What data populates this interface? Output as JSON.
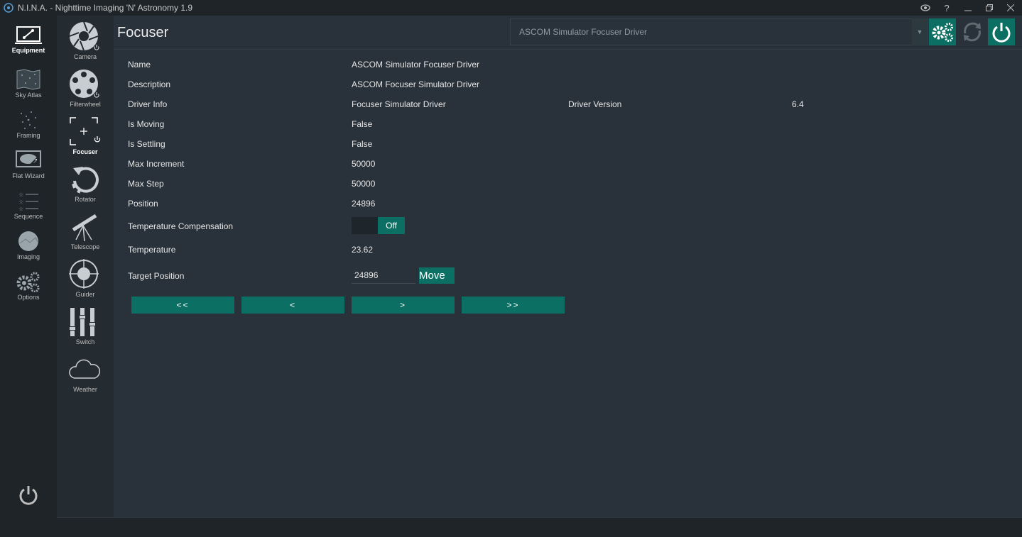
{
  "window": {
    "title": "N.I.N.A. - Nighttime Imaging 'N' Astronomy 1.9"
  },
  "leftnav": {
    "items": [
      {
        "label": "Equipment",
        "icon": "equipment-icon"
      },
      {
        "label": "Sky Atlas",
        "icon": "sky-atlas-icon"
      },
      {
        "label": "Framing",
        "icon": "framing-icon"
      },
      {
        "label": "Flat Wizard",
        "icon": "flat-wizard-icon"
      },
      {
        "label": "Sequence",
        "icon": "sequence-icon"
      },
      {
        "label": "Imaging",
        "icon": "imaging-icon"
      },
      {
        "label": "Options",
        "icon": "options-icon"
      }
    ]
  },
  "subnav": {
    "items": [
      {
        "label": "Camera",
        "icon": "camera-icon"
      },
      {
        "label": "Filterwheel",
        "icon": "filterwheel-icon"
      },
      {
        "label": "Focuser",
        "icon": "focuser-icon"
      },
      {
        "label": "Rotator",
        "icon": "rotator-icon"
      },
      {
        "label": "Telescope",
        "icon": "telescope-icon"
      },
      {
        "label": "Guider",
        "icon": "guider-icon"
      },
      {
        "label": "Switch",
        "icon": "switch-icon"
      },
      {
        "label": "Weather",
        "icon": "weather-icon"
      }
    ]
  },
  "header": {
    "title": "Focuser",
    "device_selected": "ASCOM Simulator Focuser Driver"
  },
  "details": {
    "name_label": "Name",
    "name_value": "ASCOM Simulator Focuser Driver",
    "description_label": "Description",
    "description_value": "ASCOM Focuser Simulator Driver",
    "driver_info_label": "Driver Info",
    "driver_info_value": "Focuser Simulator Driver",
    "driver_version_label": "Driver Version",
    "driver_version_value": "6.4",
    "is_moving_label": "Is Moving",
    "is_moving_value": "False",
    "is_settling_label": "Is Settling",
    "is_settling_value": "False",
    "max_increment_label": "Max Increment",
    "max_increment_value": "50000",
    "max_step_label": "Max Step",
    "max_step_value": "50000",
    "position_label": "Position",
    "position_value": "24896",
    "temp_comp_label": "Temperature Compensation",
    "temp_comp_value": "Off",
    "temperature_label": "Temperature",
    "temperature_value": "23.62",
    "target_position_label": "Target Position",
    "target_position_value": "24896",
    "move_label": "Move"
  },
  "steps": {
    "fast_left": "<<",
    "left": "<",
    "right": ">",
    "fast_right": ">>"
  },
  "colors": {
    "accent": "#0b6f63",
    "background": "#29323a",
    "sidebar": "#1e2428"
  }
}
